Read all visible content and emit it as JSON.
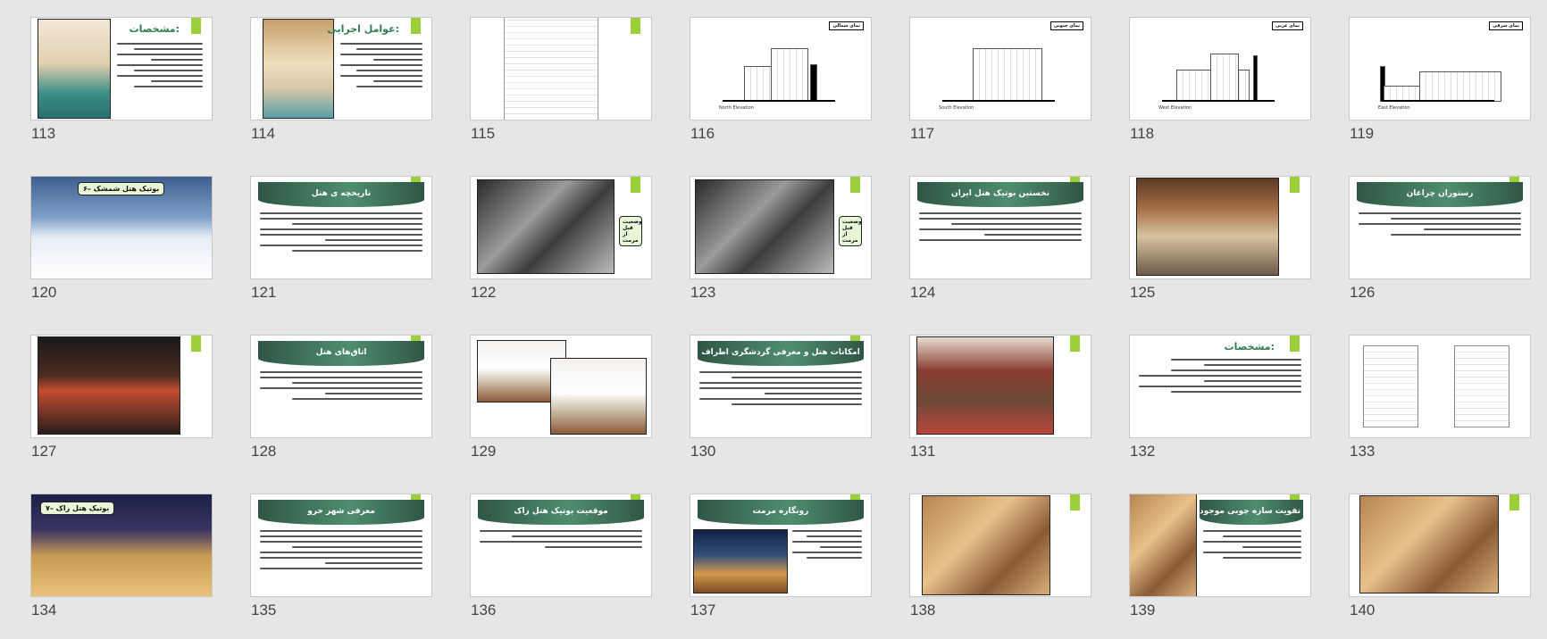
{
  "slides": [
    {
      "num": "113",
      "title": "مشخصات:"
    },
    {
      "num": "114",
      "title": "عوامل اجرایی:"
    },
    {
      "num": "115"
    },
    {
      "num": "116",
      "tag": "نمای شمالی",
      "caption": "North Elevation"
    },
    {
      "num": "117",
      "tag": "نمای جنوبی",
      "caption": "South Elevation"
    },
    {
      "num": "118",
      "tag": "نمای غربی",
      "caption": "West Elevation"
    },
    {
      "num": "119",
      "tag": "نمای شرقی",
      "caption": "East Elevation"
    },
    {
      "num": "120",
      "badge": "۶– بوتیک هتل شمشک"
    },
    {
      "num": "121",
      "title": "تاریخچه ی هتل"
    },
    {
      "num": "122",
      "badge": "وضعیت قبل از مرمت"
    },
    {
      "num": "123",
      "badge": "وضعیت قبل از مرمت"
    },
    {
      "num": "124",
      "title": "نخستین بوتیک هتل ایران"
    },
    {
      "num": "125"
    },
    {
      "num": "126",
      "title": "رستوران چراغان"
    },
    {
      "num": "127"
    },
    {
      "num": "128",
      "title": "اتاق‌های هتل"
    },
    {
      "num": "129"
    },
    {
      "num": "130",
      "title": "امکانات هتل و معرفی گردشگری اطراف"
    },
    {
      "num": "131"
    },
    {
      "num": "132",
      "title": "مشخصات:"
    },
    {
      "num": "133"
    },
    {
      "num": "134",
      "badge": "۷– بوتیک هتل زاک"
    },
    {
      "num": "135",
      "title": "معرفی شهر خرو"
    },
    {
      "num": "136",
      "title": "موقعیت بوتیک هتل زاک"
    },
    {
      "num": "137",
      "title": "رونگاره مرمت"
    },
    {
      "num": "138"
    },
    {
      "num": "139",
      "title": "حفظ و تقویت سازه چوبی موجود"
    },
    {
      "num": "140"
    }
  ]
}
